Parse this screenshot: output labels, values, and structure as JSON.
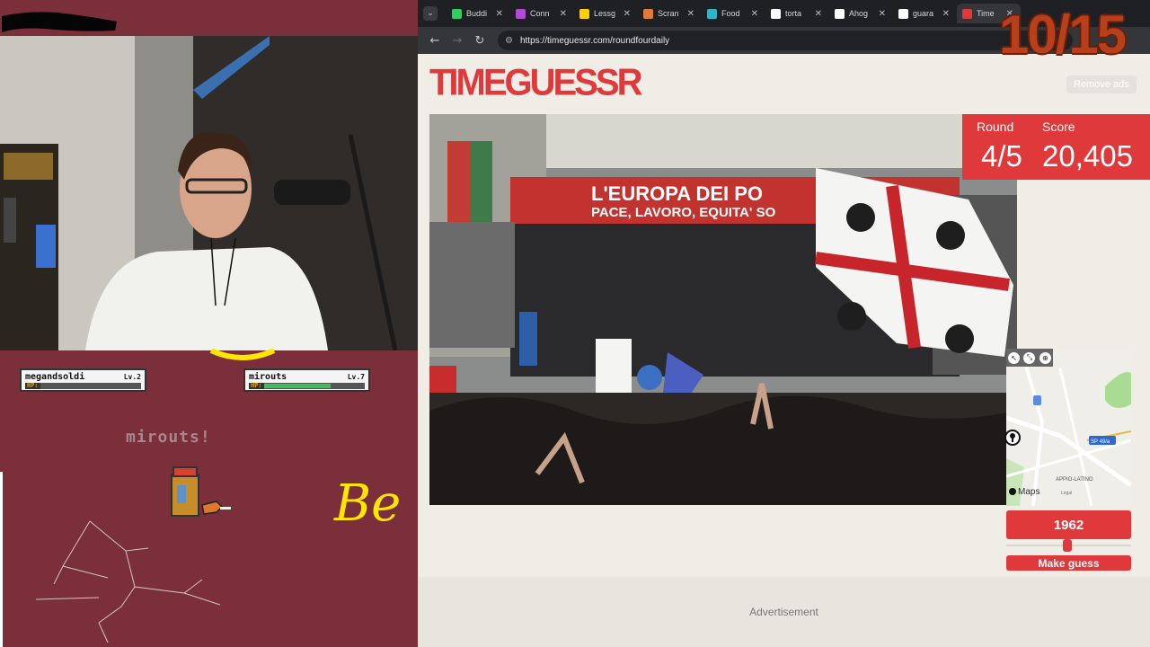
{
  "stream": {
    "players": [
      {
        "name": "megandsoldi",
        "level": "Lv.2",
        "hp_label": "HP:",
        "hp_fraction": 0.0
      },
      {
        "name": "mirouts",
        "level": "Lv.7",
        "hp_label": "HP:",
        "hp_fraction": 0.66
      }
    ],
    "battle_text": "mirouts!",
    "handwriting": "Be",
    "round_counter": "10/15"
  },
  "browser": {
    "tabs": [
      {
        "label": "Buddi",
        "favicon": "#2bd15a",
        "active": false
      },
      {
        "label": "Conn",
        "favicon": "#b04bd6",
        "active": false
      },
      {
        "label": "Lessg",
        "favicon": "#ffd000",
        "active": false
      },
      {
        "label": "Scran",
        "favicon": "#e07a3c",
        "active": false
      },
      {
        "label": "Food",
        "favicon": "#29b6c9",
        "active": false
      },
      {
        "label": "torta",
        "favicon": "#ffffff",
        "active": false
      },
      {
        "label": "Ahog",
        "favicon": "#ffffff",
        "active": false
      },
      {
        "label": "guara",
        "favicon": "#ffffff",
        "active": false
      },
      {
        "label": "Time",
        "favicon": "#e0393c",
        "active": true
      }
    ],
    "url": "https://timeguessr.com/roundfourdaily"
  },
  "timeguessr": {
    "logo": "TIMEGUESSR",
    "remove_ads": "Remove ads",
    "round_label": "Round",
    "round_value": "4/5",
    "score_label": "Score",
    "score_value": "20,405",
    "photo_banner_line1": "L'EUROPA DEI PO",
    "photo_banner_line2": "PACE, LAVORO, EQUITA' SO",
    "map_label_road": "SP 49/a",
    "map_label_area": "APPIO-LATINO",
    "map_brand": "Maps",
    "map_legal": "Legal",
    "year": "1962",
    "year_fraction": 0.49,
    "make_guess": "Make guess",
    "advertisement": "Advertisement"
  },
  "colors": {
    "accent": "#e0393c",
    "overlay_bg": "#7a2f3b",
    "page_bg": "#efede6"
  }
}
